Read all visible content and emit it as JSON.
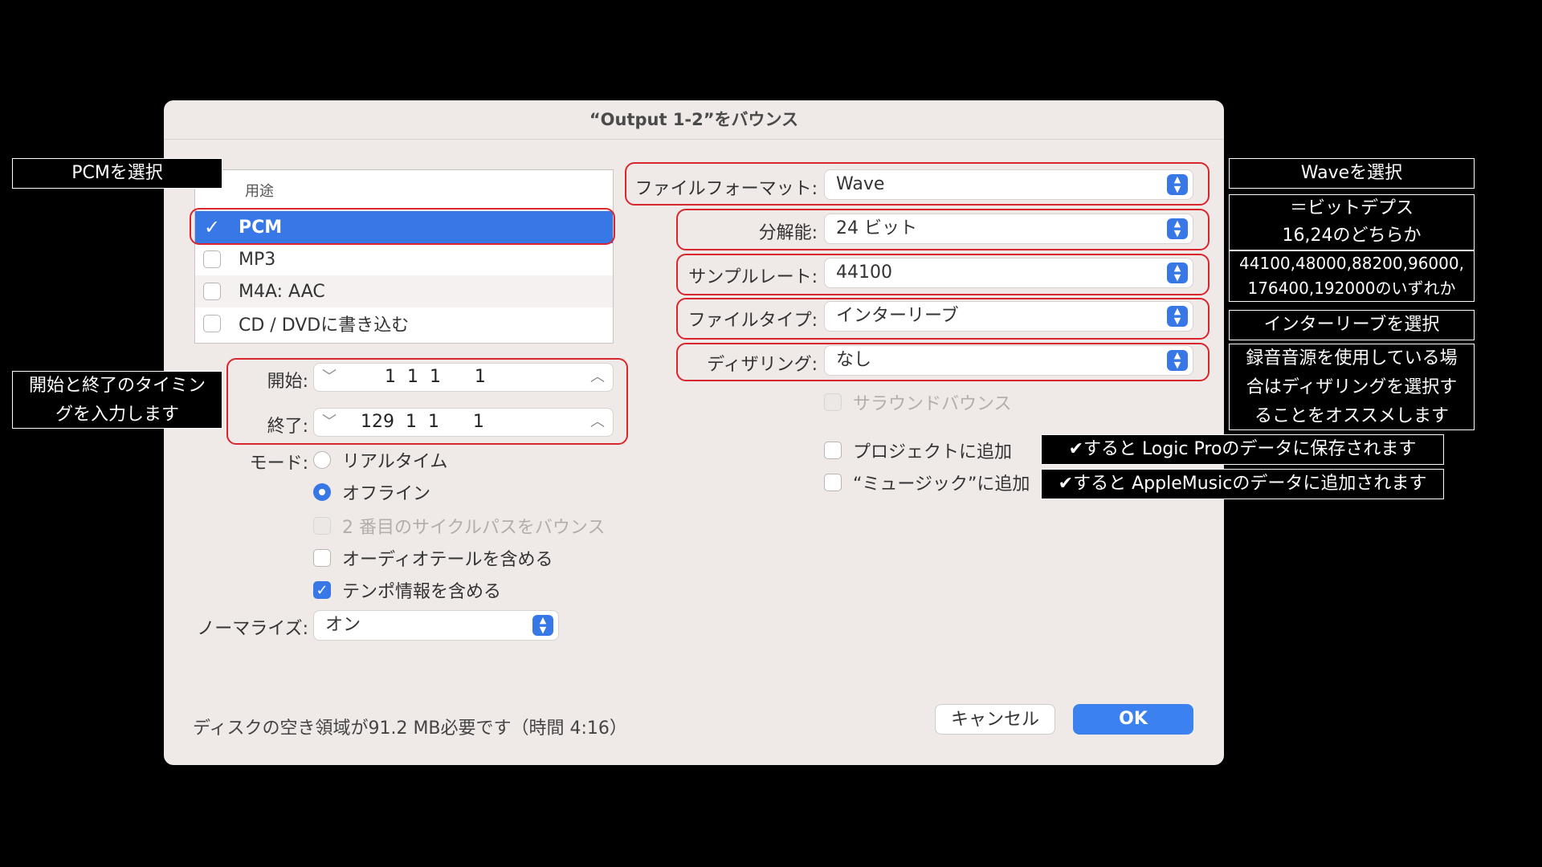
{
  "dialog": {
    "title": "“Output 1-2”をバウンス",
    "list": {
      "header": "用途",
      "items": [
        {
          "label": "PCM",
          "checked": true
        },
        {
          "label": "MP3",
          "checked": false
        },
        {
          "label": "M4A: AAC",
          "checked": false
        },
        {
          "label": "CD / DVDに書き込む",
          "checked": false
        }
      ]
    },
    "start": {
      "label": "開始:",
      "value": "1  1  1      1"
    },
    "end": {
      "label": "終了:",
      "value": "129  1  1      1"
    },
    "mode": {
      "label": "モード:",
      "options": [
        "リアルタイム",
        "オフライン"
      ],
      "selected": "オフライン"
    },
    "checkboxes": {
      "second_cycle": "2 番目のサイクルパスをバウンス",
      "audio_tail": "オーディオテールを含める",
      "tempo_info": "テンポ情報を含める"
    },
    "normalize": {
      "label": "ノーマライズ:",
      "value": "オン"
    },
    "file_format": {
      "label": "ファイルフォーマット:",
      "value": "Wave"
    },
    "resolution": {
      "label": "分解能:",
      "value": "24 ビット"
    },
    "sample_rate": {
      "label": "サンプルレート:",
      "value": "44100"
    },
    "file_type": {
      "label": "ファイルタイプ:",
      "value": "インターリーブ"
    },
    "dithering": {
      "label": "ディザリング:",
      "value": "なし"
    },
    "surround": "サラウンドバウンス",
    "add_project": "プロジェクトに追加",
    "add_music": "“ミュージック”に追加",
    "disk_info": "ディスクの空き領域が91.2 MB必要です（時間 4:16）",
    "cancel_label": "キャンセル",
    "ok_label": "OK"
  },
  "annotations": {
    "pcm": "PCMを選択",
    "timing": [
      "開始と終了のタイミン",
      "グを入力します"
    ],
    "wave": "Waveを選択",
    "bitdepth": [
      "＝ビットデプス",
      "16,24のどちらか"
    ],
    "samplerate": [
      "44100,48000,88200,96000,",
      "176400,192000のいずれか"
    ],
    "interleave": "インターリーブを選択",
    "dither": [
      "録音音源を使用している場",
      "合はディザリングを選択す",
      "ることをオススメします"
    ],
    "project": "✔すると Logic Proのデータに保存されます",
    "music": "✔すると AppleMusicのデータに追加されます"
  },
  "colors": {
    "accent": "#3877e6",
    "highlight": "#d8262c",
    "dialog_bg": "#efe9e7"
  }
}
